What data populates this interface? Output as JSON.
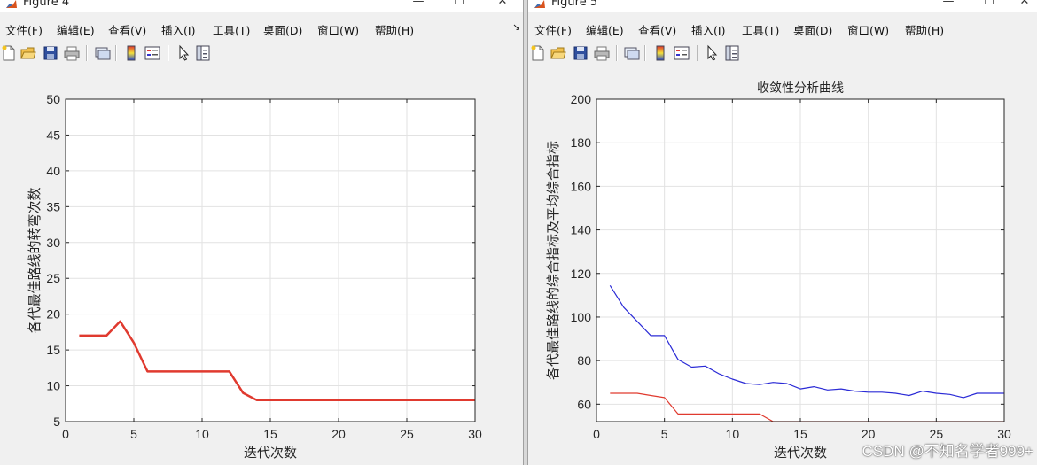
{
  "colors": {
    "line_red": "#e03a2f",
    "line_blue": "#2b2bd6",
    "grid": "#e2e2e2",
    "axis": "#262626"
  },
  "figure4": {
    "title": "Figure 4",
    "menu": [
      "文件(F)",
      "编辑(E)",
      "查看(V)",
      "插入(I)",
      "工具(T)",
      "桌面(D)",
      "窗口(W)",
      "帮助(H)"
    ],
    "menu_extra": "↘",
    "toolbar_icons": [
      "new-figure-icon",
      "open-file-icon",
      "save-icon",
      "print-icon",
      "link-plot-icon",
      "colorbar-icon",
      "legend-icon",
      "edit-plot-arrow-icon",
      "property-inspector-icon"
    ]
  },
  "figure5": {
    "title": "Figure 5",
    "menu": [
      "文件(F)",
      "编辑(E)",
      "查看(V)",
      "插入(I)",
      "工具(T)",
      "桌面(D)",
      "窗口(W)",
      "帮助(H)"
    ],
    "toolbar_icons": [
      "new-figure-icon",
      "open-file-icon",
      "save-icon",
      "print-icon",
      "link-plot-icon",
      "colorbar-icon",
      "legend-icon",
      "edit-plot-arrow-icon",
      "property-inspector-icon"
    ]
  },
  "watermark": "CSDN @不知名学者999+",
  "chart_data": [
    {
      "type": "line",
      "title": "",
      "xlabel": "迭代次数",
      "ylabel": "各代最佳路线的转弯次数",
      "xlim": [
        0,
        30
      ],
      "ylim": [
        5,
        50
      ],
      "xticks": [
        0,
        5,
        10,
        15,
        20,
        25,
        30
      ],
      "yticks": [
        5,
        10,
        15,
        20,
        25,
        30,
        35,
        40,
        45,
        50
      ],
      "grid": true,
      "series": [
        {
          "color": "#e03a2f",
          "x": [
            1,
            2,
            3,
            4,
            5,
            6,
            7,
            8,
            9,
            10,
            11,
            12,
            13,
            14,
            15,
            16,
            17,
            18,
            19,
            20,
            21,
            22,
            23,
            24,
            25,
            26,
            27,
            28,
            29,
            30
          ],
          "y": [
            17,
            17,
            17,
            19,
            16,
            12,
            12,
            12,
            12,
            12,
            12,
            12,
            9,
            8,
            8,
            8,
            8,
            8,
            8,
            8,
            8,
            8,
            8,
            8,
            8,
            8,
            8,
            8,
            8,
            8
          ]
        }
      ]
    },
    {
      "type": "line",
      "title": "收敛性分析曲线",
      "xlabel": "迭代次数",
      "ylabel": "各代最佳路线的综合指标及平均综合指标",
      "xlim": [
        0,
        30
      ],
      "ylim": [
        52,
        200
      ],
      "xticks": [
        0,
        5,
        10,
        15,
        20,
        25,
        30
      ],
      "yticks": [
        60,
        80,
        100,
        120,
        140,
        160,
        180,
        200
      ],
      "grid": true,
      "series": [
        {
          "color": "#2b2bd6",
          "x": [
            1,
            2,
            3,
            4,
            5,
            6,
            7,
            8,
            9,
            10,
            11,
            12,
            13,
            14,
            15,
            16,
            17,
            18,
            19,
            20,
            21,
            22,
            23,
            24,
            25,
            26,
            27,
            28,
            29,
            30
          ],
          "y": [
            114.5,
            104.5,
            98,
            91.5,
            91.5,
            80.5,
            77,
            77.5,
            74,
            71.5,
            69.5,
            69,
            70,
            69.5,
            67,
            68,
            66.5,
            67,
            66,
            65.5,
            65.5,
            65,
            64,
            66,
            65,
            64.5,
            63,
            65,
            65,
            65
          ]
        },
        {
          "color": "#e03a2f",
          "x": [
            1,
            2,
            3,
            4,
            5,
            6,
            7,
            8,
            9,
            10,
            11,
            12,
            13,
            14,
            15,
            16,
            17,
            18,
            19,
            20,
            21,
            22,
            23,
            24,
            25,
            26,
            27,
            28,
            29,
            30
          ],
          "y": [
            65,
            65,
            65,
            64,
            63,
            55.5,
            55.5,
            55.5,
            55.5,
            55.5,
            55.5,
            55.5,
            52,
            52,
            52,
            52,
            52,
            52,
            52,
            52,
            52,
            52,
            52,
            52,
            52,
            52,
            52,
            52,
            52,
            52
          ]
        }
      ]
    }
  ]
}
